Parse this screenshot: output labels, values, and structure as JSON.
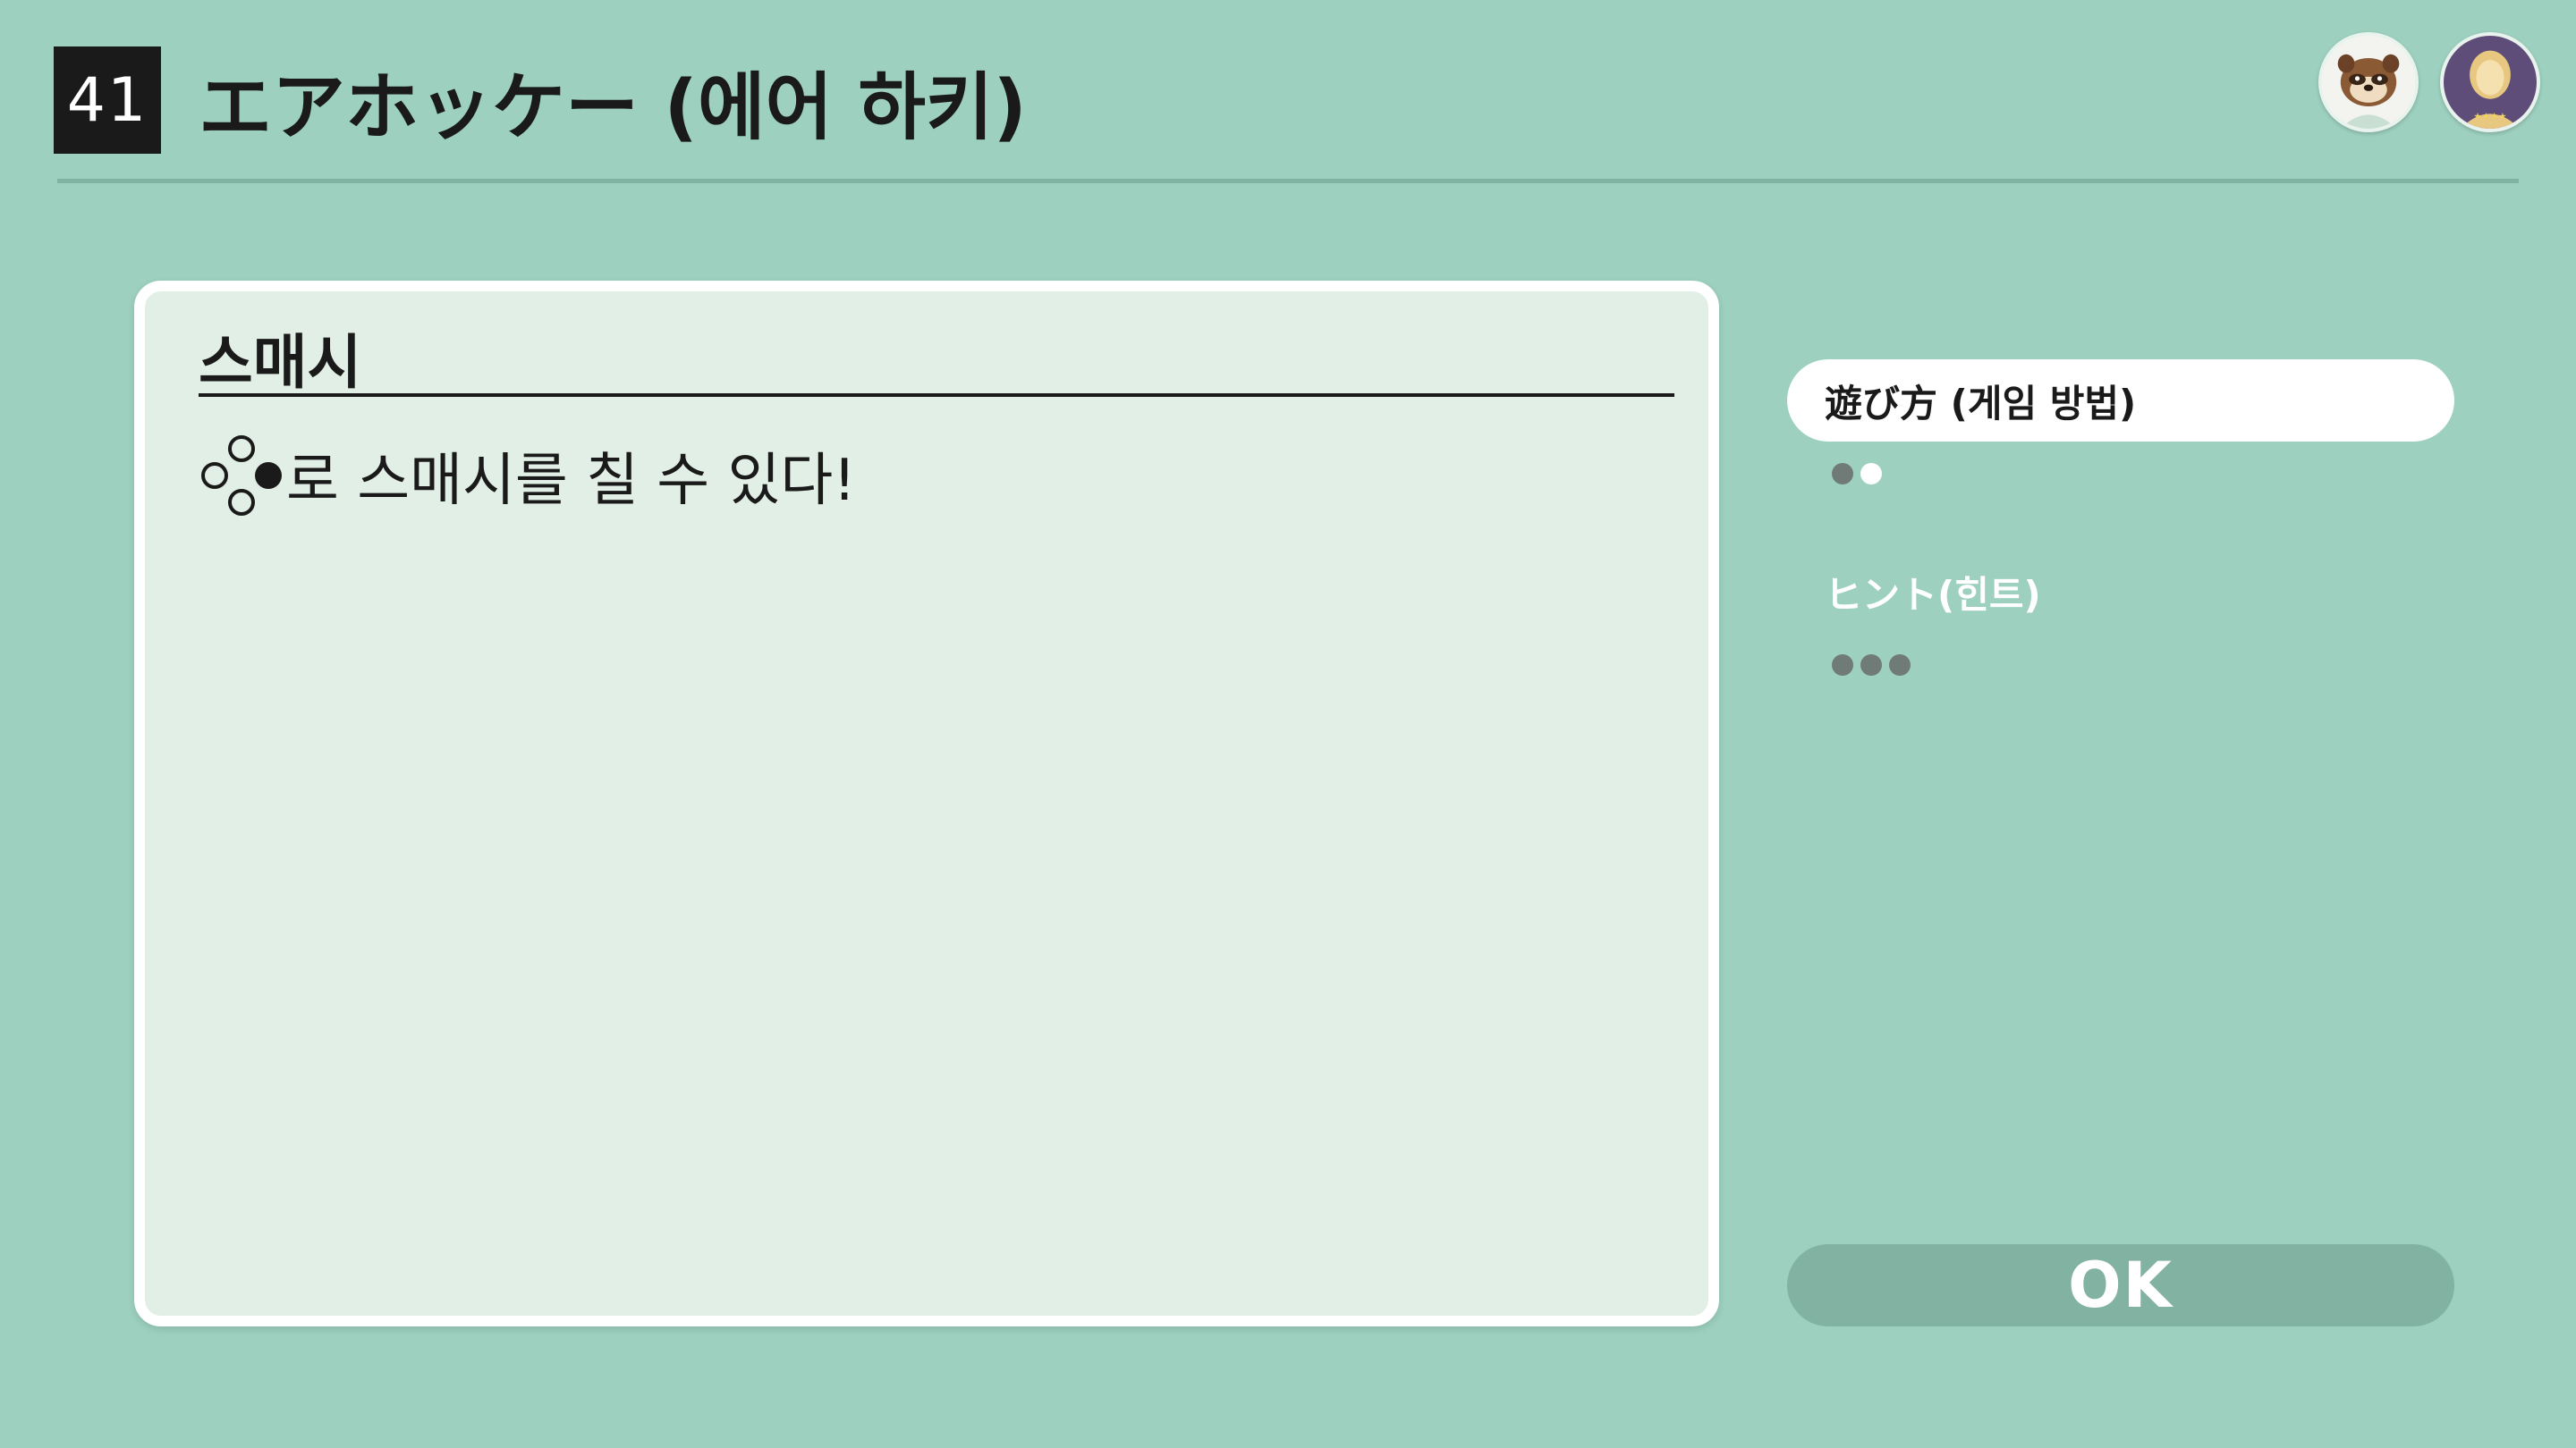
{
  "header": {
    "number": "41",
    "title": "エアホッケー (에어 하키)"
  },
  "avatars": [
    {
      "icon": "raccoon-character-icon"
    },
    {
      "icon": "player-silhouette-icon"
    }
  ],
  "panel": {
    "heading": "스매시",
    "body_text": "로 스매시를 칠 수 있다!",
    "button_icon": "right-face-button-icon"
  },
  "nav": {
    "items": [
      {
        "label": "遊び方 (게임 방법)",
        "selected": true
      },
      {
        "label": "ヒント(힌트)",
        "selected": false
      }
    ],
    "page_indicators": [
      {
        "total": 2,
        "current": 2
      },
      {
        "total": 3,
        "current": 0
      }
    ]
  },
  "ok_button": {
    "label": "OK"
  },
  "colors": {
    "background": "#9dd0bf",
    "panel": "#e2efe6",
    "ok_button": "#82b2a1",
    "dark": "#1a1a1a"
  }
}
